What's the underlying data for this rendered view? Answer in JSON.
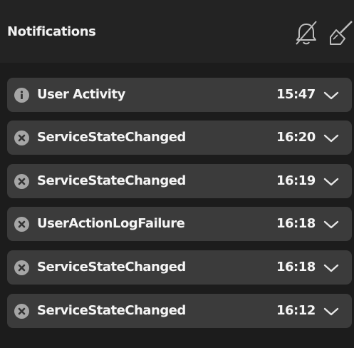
{
  "header": {
    "title": "Notifications",
    "mute_icon": "bell-slash-icon",
    "clear_icon": "broom-icon"
  },
  "colors": {
    "background": "#1c1c1c",
    "header": "#232323",
    "item": "#3b3b3b",
    "icon": "#a6a6a6",
    "text": "#f5f5f5"
  },
  "notifications": [
    {
      "label": "User Activity",
      "time": "15:47",
      "severity": "info",
      "icon": "info-icon"
    },
    {
      "label": "ServiceStateChanged",
      "time": "16:20",
      "severity": "error",
      "icon": "error-x-icon"
    },
    {
      "label": "ServiceStateChanged",
      "time": "16:19",
      "severity": "error",
      "icon": "error-x-icon"
    },
    {
      "label": "UserActionLogFailure",
      "time": "16:18",
      "severity": "error",
      "icon": "error-x-icon"
    },
    {
      "label": "ServiceStateChanged",
      "time": "16:18",
      "severity": "error",
      "icon": "error-x-icon"
    },
    {
      "label": "ServiceStateChanged",
      "time": "16:12",
      "severity": "error",
      "icon": "error-x-icon"
    }
  ]
}
